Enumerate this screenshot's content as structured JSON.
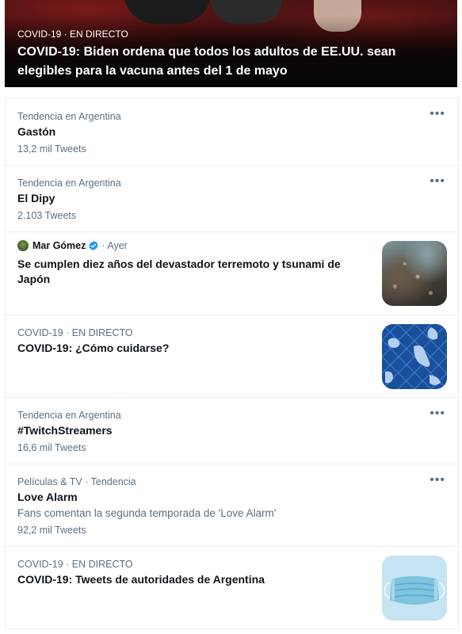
{
  "hero": {
    "category": "COVID-19 · EN DIRECTO",
    "title": "COVID-19: Biden ordena que todos los adultos de EE.UU. sean elegibles para la vacuna antes del 1 de mayo"
  },
  "more_label": "•••",
  "trends": [
    {
      "meta": "Tendencia en Argentina",
      "title": "Gastón",
      "count": "13,2 mil Tweets"
    },
    {
      "meta": "Tendencia en Argentina",
      "title": "El Dipy",
      "count": "2.103 Tweets"
    }
  ],
  "story_quake": {
    "author": "Mar Gómez",
    "time": "· Ayer",
    "title": "Se cumplen diez años del devastador terremoto y tsunami de Japón",
    "thumb_icon": "earthquake-debris-photo"
  },
  "story_cuidarse": {
    "category": "COVID-19 · EN DIRECTO",
    "title": "COVID-19: ¿Cómo cuidarse?",
    "thumb_icon": "gloves-pattern-photo"
  },
  "trend_twitch": {
    "meta": "Tendencia en Argentina",
    "title": "#TwitchStreamers",
    "count": "16,6 mil Tweets"
  },
  "trend_love": {
    "meta": "Películas & TV · Tendencia",
    "title": "Love Alarm",
    "description": "Fans comentan la segunda temporada de 'Love Alarm'",
    "count": "92,2 mil Tweets"
  },
  "story_autoridades": {
    "category": "COVID-19 · EN DIRECTO",
    "title": "COVID-19: Tweets de autoridades de Argentina",
    "thumb_icon": "face-mask-photo"
  },
  "colors": {
    "accent": "#1d9bf0",
    "secondary_text": "#5b7083",
    "primary_text": "#0f1419"
  }
}
